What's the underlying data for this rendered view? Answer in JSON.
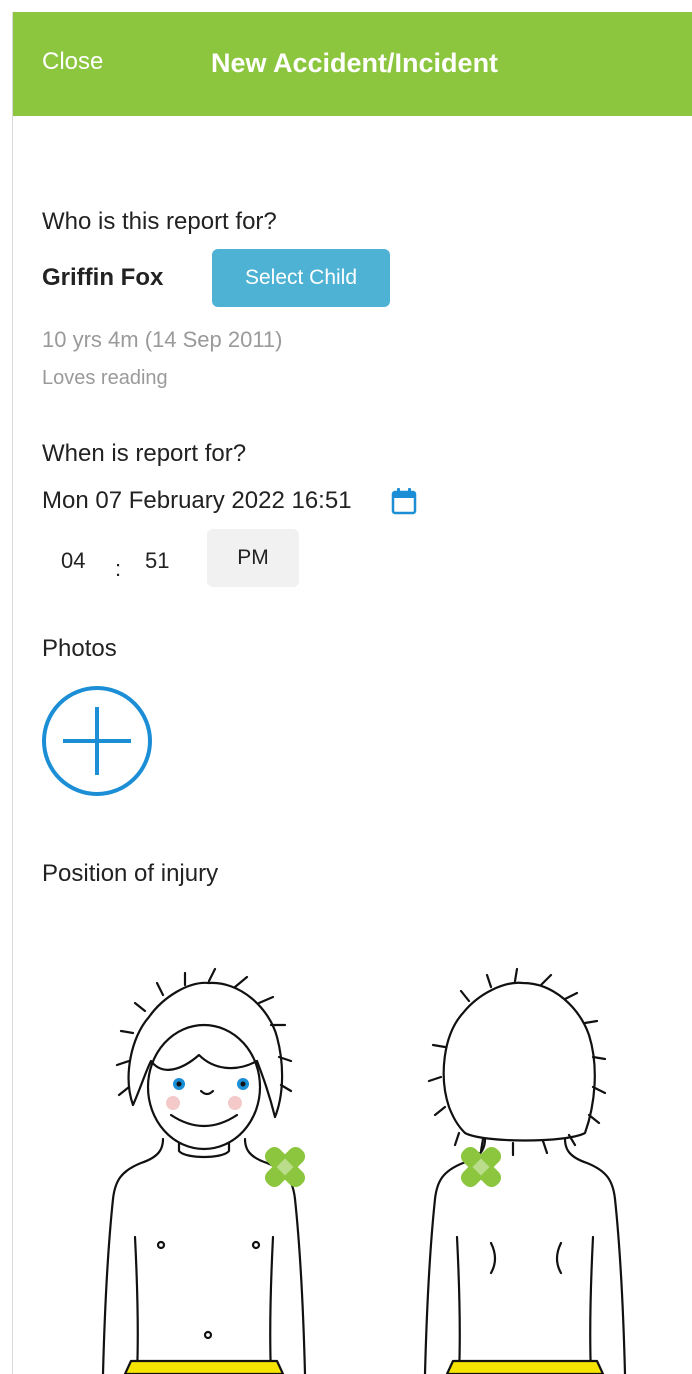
{
  "header": {
    "close_label": "Close",
    "title": "New Accident/Incident"
  },
  "child": {
    "question": "Who is this report for?",
    "name": "Griffin Fox",
    "select_button_label": "Select Child",
    "age": "10 yrs 4m (14 Sep 2011)",
    "note": "Loves reading"
  },
  "when": {
    "question": "When is report for?",
    "datetime": "Mon 07 February 2022 16:51",
    "hour": "04",
    "separator": ":",
    "minute": "51",
    "ampm": "PM"
  },
  "photos": {
    "label": "Photos"
  },
  "injury": {
    "label": "Position of injury",
    "markers": [
      "front-right-shoulder",
      "back-left-shoulder"
    ]
  },
  "colors": {
    "accent_green": "#8cc63f",
    "button_blue": "#4db2d4",
    "icon_blue": "#1b8ed6",
    "muted_text": "#9a9a9a",
    "plaster_green": "#8cc63f",
    "shorts_yellow": "#f5e400"
  },
  "icons": {
    "calendar": "calendar-icon",
    "add": "plus-circle-icon",
    "plaster": "plaster-icon"
  }
}
